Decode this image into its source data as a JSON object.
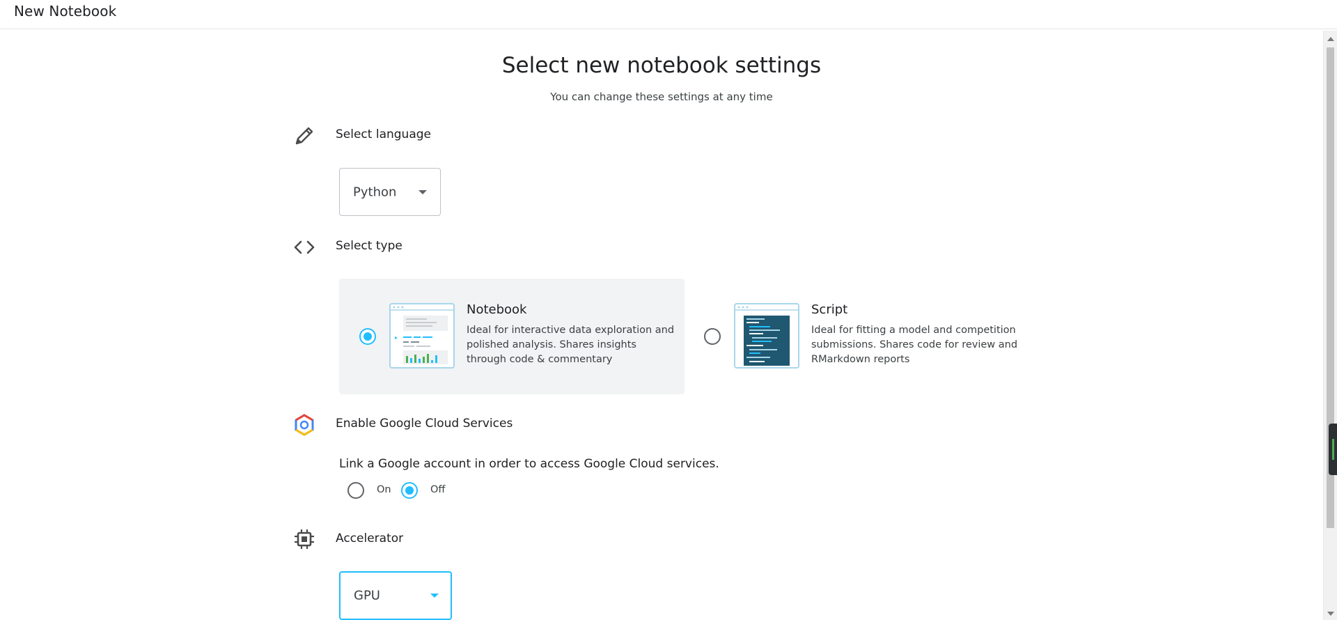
{
  "window": {
    "title": "New Notebook"
  },
  "header": {
    "title": "Select new notebook settings",
    "subtitle": "You can change these settings at any time"
  },
  "language": {
    "label": "Select language",
    "icon": "pencil-icon",
    "selected": "Python"
  },
  "type": {
    "label": "Select type",
    "icon": "code-brackets-icon",
    "options": [
      {
        "title": "Notebook",
        "description": "Ideal for interactive data exploration and polished analysis. Shares insights through code & commentary",
        "selected": true
      },
      {
        "title": "Script",
        "description": "Ideal for fitting a model and competition submissions. Shares code for review and RMarkdown reports",
        "selected": false
      }
    ]
  },
  "gcs": {
    "label": "Enable Google Cloud Services",
    "icon": "google-cloud-icon",
    "text": "Link a Google account in order to access Google Cloud services.",
    "on_label": "On",
    "off_label": "Off",
    "selected": "Off"
  },
  "accelerator": {
    "label": "Accelerator",
    "icon": "chip-icon",
    "selected": "GPU"
  },
  "colors": {
    "accent": "#20beff",
    "card_selected_bg": "#f1f3f4",
    "text": "#202124"
  }
}
